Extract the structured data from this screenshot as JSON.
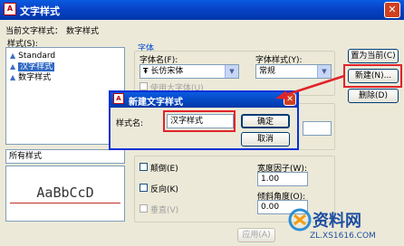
{
  "window": {
    "title": "文字样式",
    "icon": "autocad-app-icon"
  },
  "current_style": {
    "label": "当前文字样式：",
    "value": "数字样式"
  },
  "styles_label": "样式(S):",
  "styles": [
    "Standard",
    "汉字样式",
    "数字样式"
  ],
  "filter": {
    "value": "所有样式"
  },
  "preview_text": "AaBbCcD",
  "font_group": {
    "title": "字体",
    "font_name_label": "字体名(F):",
    "font_name_value": "长仿宋体",
    "font_style_label": "字体样式(Y):",
    "font_style_value": "常规",
    "big_font_label": "使用大字体(U)"
  },
  "buttons": {
    "set_current": "置为当前(C)",
    "new": "新建(N)...",
    "delete": "删除(D)",
    "apply": "应用(A)"
  },
  "effects": {
    "upside_down": "颠倒(E)",
    "backwards": "反向(K)",
    "vertical": "垂直(V)",
    "width_factor_label": "宽度因子(W):",
    "width_factor_value": "1.00",
    "oblique_label": "倾斜角度(O):",
    "oblique_value": "0.00"
  },
  "new_style_dialog": {
    "title": "新建文字样式",
    "name_label": "样式名:",
    "name_value": "汉字样式",
    "ok": "确定",
    "cancel": "取消"
  },
  "watermark": {
    "logo_text": "资料网",
    "url": "ZL.XS1616.COM"
  },
  "colors": {
    "highlight": "#e0232a",
    "titlebar": "#0a5be0",
    "selection": "#316ac5"
  }
}
